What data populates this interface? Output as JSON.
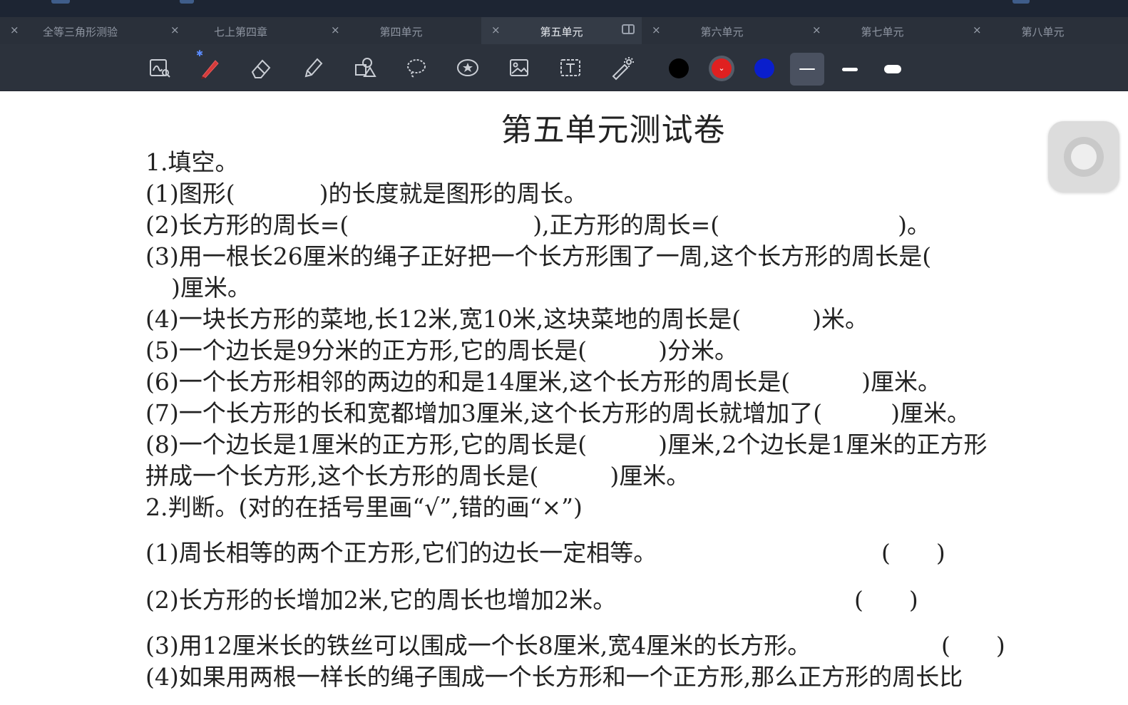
{
  "tabs": [
    {
      "label": "全等三角形测验",
      "active": false
    },
    {
      "label": "七上第四章",
      "active": false
    },
    {
      "label": "第四单元",
      "active": false
    },
    {
      "label": "第五单元",
      "active": true
    },
    {
      "label": "第六单元",
      "active": false
    },
    {
      "label": "第七单元",
      "active": false
    },
    {
      "label": "第八单元",
      "active": false
    }
  ],
  "tab_close_glyph": "×",
  "toolbar": {
    "tools": [
      "zoom-tool-icon",
      "pen-icon",
      "eraser-icon",
      "highlighter-icon",
      "shapes-icon",
      "lasso-icon",
      "sticker-icon",
      "image-icon",
      "text-box-icon",
      "laser-pointer-icon"
    ],
    "bluetooth_glyph": "✱",
    "colors": [
      "#000000",
      "#e02020",
      "#0a1ecc"
    ],
    "selected_color": "#e02020",
    "selected_color_chevron": "⌄",
    "stroke_sizes": [
      "thin",
      "medium",
      "thick"
    ],
    "selected_stroke": "thin"
  },
  "document": {
    "title": "第五单元测试卷",
    "q1_heading": "1.填空。",
    "q1_1a": "(1)图形(",
    "q1_1b": ")的长度就是图形的周长。",
    "q1_2a": "(2)长方形的周长=(",
    "q1_2b": "),正方形的周长=(",
    "q1_2c": ")。",
    "q1_3a": "(3)用一根长26厘米的绳子正好把一个长方形围了一周,这个长方形的周长是(",
    "q1_3b": ")厘米。",
    "q1_4a": "(4)一块长方形的菜地,长12米,宽10米,这块菜地的周长是(",
    "q1_4b": ")米。",
    "q1_5a": "(5)一个边长是9分米的正方形,它的周长是(",
    "q1_5b": ")分米。",
    "q1_6a": "(6)一个长方形相邻的两边的和是14厘米,这个长方形的周长是(",
    "q1_6b": ")厘米。",
    "q1_7a": "(7)一个长方形的长和宽都增加3厘米,这个长方形的周长就增加了(",
    "q1_7b": ")厘米。",
    "q1_8a": "(8)一个边长是1厘米的正方形,它的周长是(",
    "q1_8b": ")厘米,2个边长是1厘米的正方形",
    "q1_8c": "拼成一个长方形,这个长方形的周长是(",
    "q1_8d": ")厘米。",
    "q2_heading": "2.判断。(对的在括号里画“√”,错的画“×”)",
    "q2_1": "(1)周长相等的两个正方形,它们的边长一定相等。",
    "q2_2": "(2)长方形的长增加2米,它的周长也增加2米。",
    "q2_3": "(3)用12厘米长的铁丝可以围成一个长8厘米,宽4厘米的长方形。",
    "q2_4": "(4)如果用两根一样长的绳子围成一个长方形和一个正方形,那么正方形的周长比",
    "paren_open": "(",
    "paren_close": ")"
  }
}
